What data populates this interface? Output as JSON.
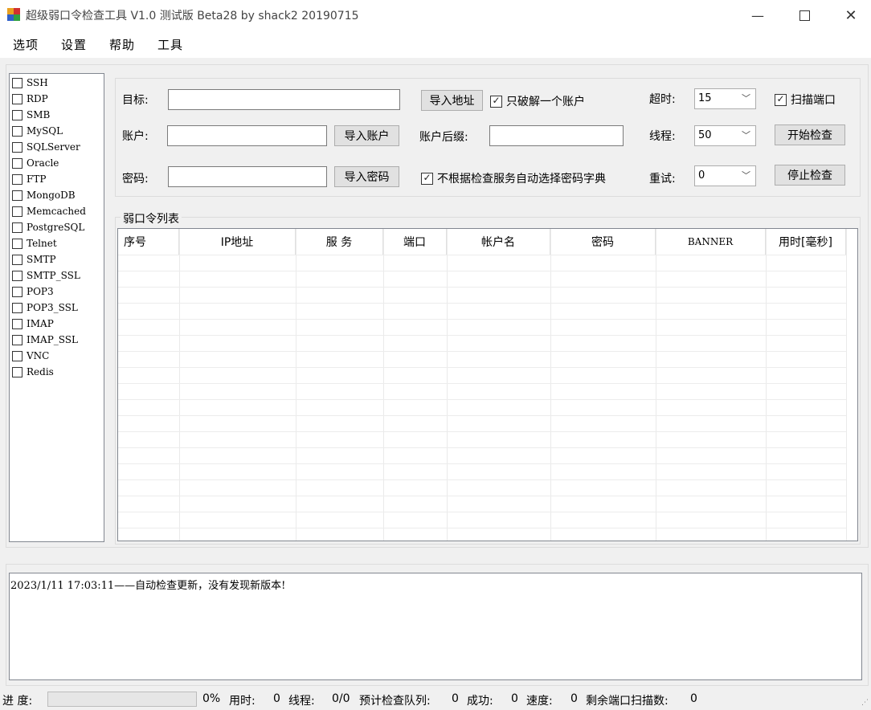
{
  "window": {
    "title": "超级弱口令检查工具 V1.0 测试版 Beta28 by shack2 20190715"
  },
  "menu": [
    "选项",
    "设置",
    "帮助",
    "工具"
  ],
  "services": [
    {
      "label": "SSH",
      "checked": false
    },
    {
      "label": "RDP",
      "checked": false
    },
    {
      "label": "SMB",
      "checked": false
    },
    {
      "label": "MySQL",
      "checked": false
    },
    {
      "label": "SQLServer",
      "checked": false
    },
    {
      "label": "Oracle",
      "checked": false
    },
    {
      "label": "FTP",
      "checked": false
    },
    {
      "label": "MongoDB",
      "checked": false
    },
    {
      "label": "Memcached",
      "checked": false
    },
    {
      "label": "PostgreSQL",
      "checked": false
    },
    {
      "label": "Telnet",
      "checked": false
    },
    {
      "label": "SMTP",
      "checked": false
    },
    {
      "label": "SMTP_SSL",
      "checked": false
    },
    {
      "label": "POP3",
      "checked": false
    },
    {
      "label": "POP3_SSL",
      "checked": false
    },
    {
      "label": "IMAP",
      "checked": false
    },
    {
      "label": "IMAP_SSL",
      "checked": false
    },
    {
      "label": "VNC",
      "checked": false
    },
    {
      "label": "Redis",
      "checked": false
    }
  ],
  "config": {
    "target_label": "目标:",
    "target_value": "",
    "account_label": "账户:",
    "account_value": "",
    "password_label": "密码:",
    "password_value": "",
    "import_address": "导入地址",
    "import_account": "导入账户",
    "import_password": "导入密码",
    "only_one_account": {
      "label": "只破解一个账户",
      "checked": true
    },
    "account_suffix_label": "账户后缀:",
    "account_suffix_value": "",
    "no_auto_dict": {
      "label": "不根据检查服务自动选择密码字典",
      "checked": true
    },
    "timeout_label": "超时:",
    "timeout_value": "15",
    "threads_label": "线程:",
    "threads_value": "50",
    "retry_label": "重试:",
    "retry_value": "0",
    "scan_port": {
      "label": "扫描端口",
      "checked": true
    },
    "start_check": "开始检查",
    "stop_check": "停止检查"
  },
  "weak_list": {
    "title": "弱口令列表",
    "columns": [
      "序号",
      "IP地址",
      "服 务",
      "端口",
      "帐户名",
      "密码",
      "BANNER",
      "用时[毫秒]"
    ]
  },
  "log": {
    "text": "2023/1/11 17:03:11——自动检查更新，没有发现新版本!"
  },
  "status": {
    "progress_label": "进 度:",
    "progress_percent": 0,
    "progress_text": "0%",
    "elapsed_label": "用时:",
    "elapsed_value": "0",
    "threads_label": "线程:",
    "threads_value": "0/0",
    "queue_label": "预计检查队列:",
    "queue_value": "0",
    "success_label": "成功:",
    "success_value": "0",
    "speed_label": "速度:",
    "speed_value": "0",
    "remaining_label": "剩余端口扫描数:",
    "remaining_value": "0"
  }
}
